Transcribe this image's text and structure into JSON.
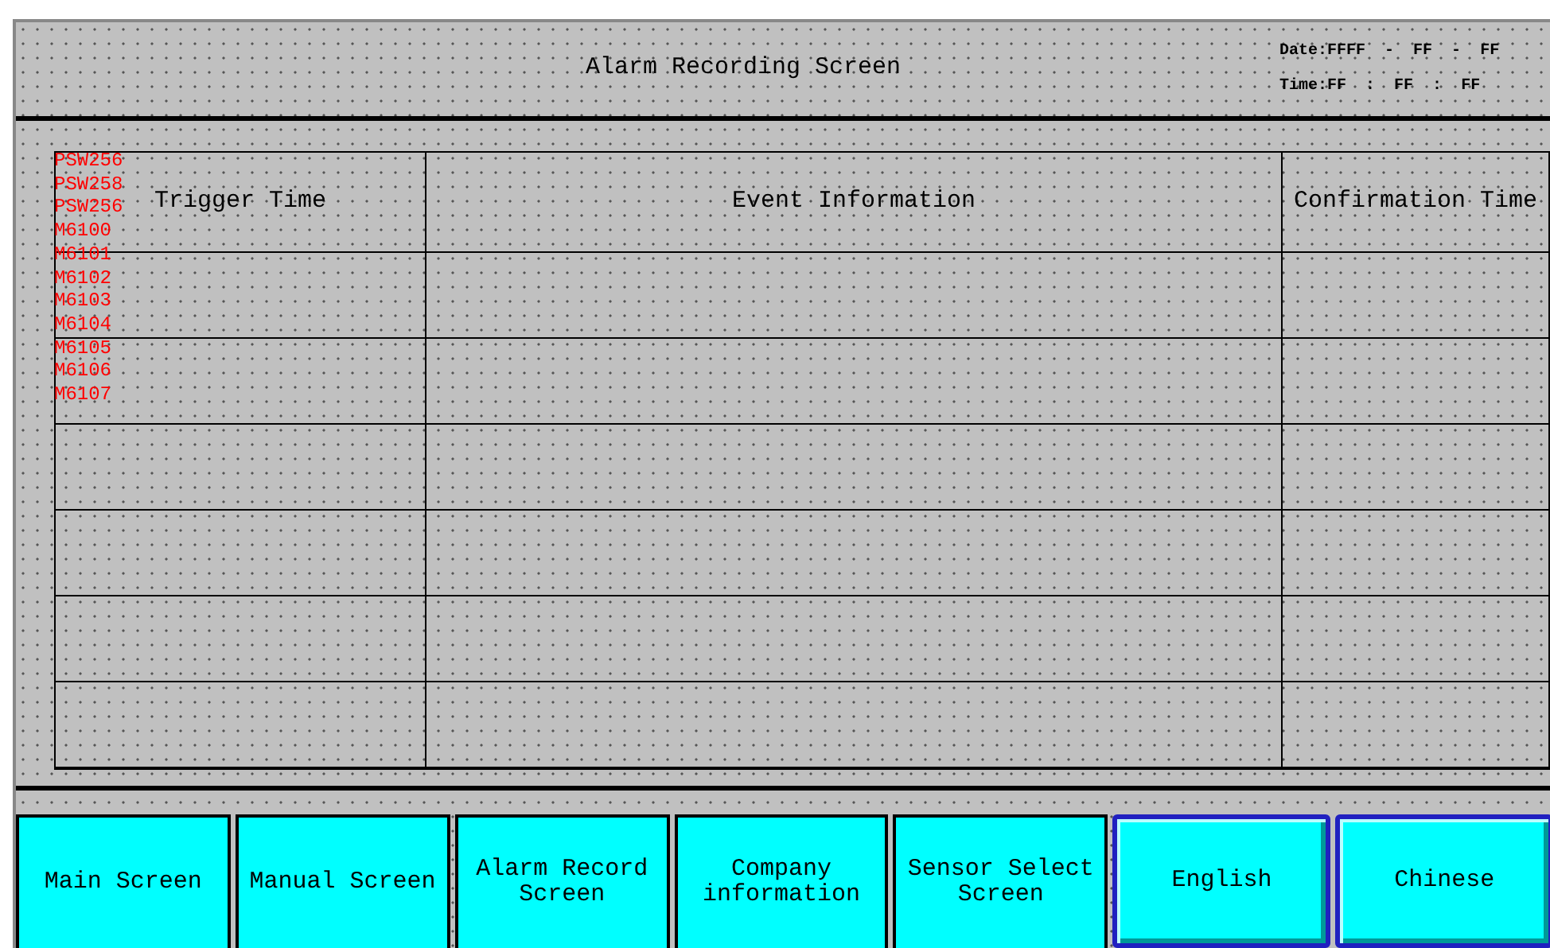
{
  "header": {
    "title": "Alarm Recording Screen",
    "date": [
      "Date:FFFF",
      "-",
      "FF",
      "-",
      "FF"
    ],
    "time": [
      "Time:FF",
      ":",
      "FF",
      ":",
      "FF"
    ]
  },
  "table": {
    "columns": [
      "Trigger Time",
      "Event Information",
      "Confirmation Time"
    ]
  },
  "address_tags": [
    "PSW256",
    "PSW258",
    "PSW256",
    "M6100",
    "M6101",
    "M6102",
    "M6103",
    "M6104",
    "M6105",
    "M6106",
    "M6107"
  ],
  "buttons": [
    {
      "label": "Main Screen",
      "kind": "flat"
    },
    {
      "label": "Manual Screen",
      "kind": "flat"
    },
    {
      "label": "Alarm Record\nScreen",
      "kind": "flat"
    },
    {
      "label": "Company\ninformation",
      "kind": "flat"
    },
    {
      "label": "Sensor Select\nScreen",
      "kind": "flat"
    },
    {
      "label": "English",
      "kind": "raised"
    },
    {
      "label": "Chinese",
      "kind": "raised"
    }
  ]
}
